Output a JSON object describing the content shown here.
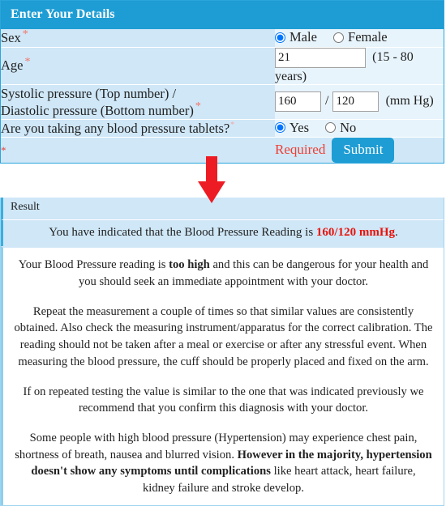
{
  "form": {
    "header_title": "Enter Your Details",
    "required_marker": "*",
    "rows": {
      "sex": {
        "label": "Sex",
        "options": [
          {
            "label": "Male",
            "checked": true
          },
          {
            "label": "Female",
            "checked": false
          }
        ]
      },
      "age": {
        "label": "Age",
        "value": "21",
        "placeholder": "",
        "hint": "(15 - 80 years)"
      },
      "pressure": {
        "label_line1": "Systolic pressure (Top number) /",
        "label_line2": "Diastolic pressure (Bottom number)",
        "systolic_value": "160",
        "diastolic_value": "120",
        "separator": "/",
        "hint": "(mm Hg)"
      },
      "tablets": {
        "label": "Are you taking any blood pressure tablets?",
        "options": [
          {
            "label": "Yes",
            "checked": true
          },
          {
            "label": "No",
            "checked": false
          }
        ]
      }
    },
    "footer": {
      "star": "*",
      "required_text": "Required",
      "submit_label": "Submit"
    }
  },
  "arrow": {
    "name": "down-arrow",
    "color": "#ed1c24"
  },
  "result": {
    "header_title": "Result",
    "reading_prefix": "You have indicated that the Blood Pressure Reading is ",
    "reading_value": "160/120 mmHg",
    "reading_suffix": ".",
    "paragraphs": [
      {
        "segments": [
          {
            "text": "Your Blood Pressure reading is ",
            "bold": false
          },
          {
            "text": "too high",
            "bold": true
          },
          {
            "text": " and this can be dangerous for your health and you should seek an immediate appointment with your doctor.",
            "bold": false
          }
        ]
      },
      {
        "segments": [
          {
            "text": "Repeat the measurement a couple of times so that similar values are consistently obtained. Also check the measuring instrument/apparatus for the correct calibration. The reading should not be taken after a meal or exercise or after any stressful event. When measuring the blood pressure, the cuff should be properly placed and fixed on the arm.",
            "bold": false
          }
        ]
      },
      {
        "segments": [
          {
            "text": "If on repeated testing the value is similar to the one that was indicated previously we recommend that you confirm this diagnosis with your doctor.",
            "bold": false
          }
        ]
      },
      {
        "segments": [
          {
            "text": "Some people with high blood pressure (Hypertension) may experience chest pain, shortness of breath, nausea and blurred vision. ",
            "bold": false
          },
          {
            "text": "However in the majority, hypertension doesn't show any symptoms until complications",
            "bold": true
          },
          {
            "text": " like heart attack, heart failure, kidney failure and stroke develop.",
            "bold": false
          }
        ]
      }
    ]
  },
  "colors": {
    "brand_blue": "#1e9dd4",
    "row_label_bg": "#cfe7f7",
    "row_input_bg": "#e8f4fc",
    "required_red": "#ef3e33",
    "reading_red": "#e8120b",
    "arrow_red": "#ed1c24"
  }
}
